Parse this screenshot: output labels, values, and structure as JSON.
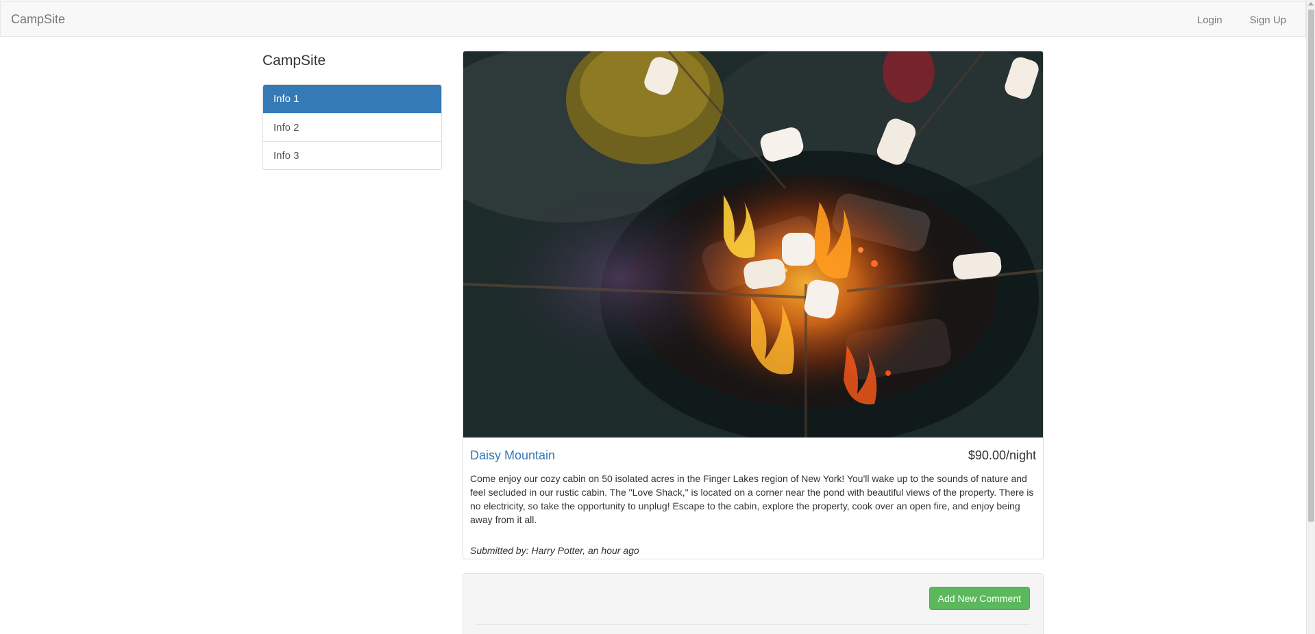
{
  "navbar": {
    "brand": "CampSite",
    "login": "Login",
    "signup": "Sign Up"
  },
  "sidebar": {
    "title": "CampSite",
    "items": [
      {
        "label": "Info 1",
        "active": true
      },
      {
        "label": "Info 2",
        "active": false
      },
      {
        "label": "Info 3",
        "active": false
      }
    ]
  },
  "campground": {
    "name": "Daisy Mountain",
    "price": "$90.00/night",
    "description": "Come enjoy our cozy cabin on 50 isolated acres in the Finger Lakes region of New York! You'll wake up to the sounds of nature and feel secluded in our rustic cabin. The \"Love Shack,\" is located on a corner near the pond with beautiful views of the property. There is no electricity, so take the opportunity to unplug! Escape to the cabin, explore the property, cook over an open fire, and enjoy being away from it all.",
    "submitted": "Submitted by: Harry Potter, an hour ago"
  },
  "comments": {
    "add_button": "Add New Comment"
  },
  "colors": {
    "accent": "#337ab7",
    "success": "#5cb85c",
    "navbar_bg": "#f8f8f8"
  }
}
